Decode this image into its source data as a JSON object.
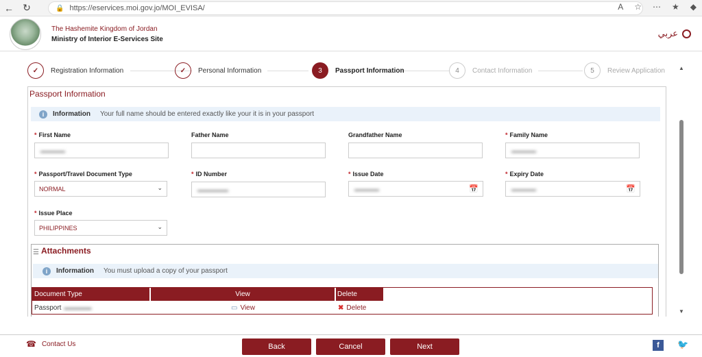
{
  "browser": {
    "url": "https://eservices.moi.gov.jo/MOI_EVISA/"
  },
  "header": {
    "kingdom": "The Hashemite Kingdom of Jordan",
    "ministry": "Ministry of Interior E-Services Site",
    "lang_label": "عربي"
  },
  "steps": [
    {
      "num": "✓",
      "label": "Registration Information",
      "state": "done"
    },
    {
      "num": "✓",
      "label": "Personal Information",
      "state": "done"
    },
    {
      "num": "3",
      "label": "Passport Information",
      "state": "active"
    },
    {
      "num": "4",
      "label": "Contact Information",
      "state": "todo"
    },
    {
      "num": "5",
      "label": "Review Application",
      "state": "todo"
    }
  ],
  "passport": {
    "title": "Passport Information",
    "info_head": "Information",
    "info_msg": "Your full name should be entered exactly like your it is in your passport",
    "fields": {
      "first_name_label": "First Name",
      "father_name_label": "Father Name",
      "grandfather_name_label": "Grandfather Name",
      "family_name_label": "Family Name",
      "doc_type_label": "Passport/Travel Document Type",
      "doc_type_value": "NORMAL",
      "id_number_label": "ID Number",
      "issue_date_label": "Issue Date",
      "expiry_date_label": "Expiry Date",
      "issue_place_label": "Issue Place",
      "issue_place_value": "PHILIPPINES",
      "required_mark": "*"
    }
  },
  "attachments": {
    "title": "Attachments",
    "info_head": "Information",
    "info_msg": "You must upload a copy of your passport",
    "columns": [
      "Document Type",
      "View",
      "Delete"
    ],
    "rows": [
      {
        "doc_type": "Passport",
        "view": "View",
        "delete": "Delete"
      }
    ]
  },
  "footer": {
    "contact": "Contact Us",
    "back": "Back",
    "cancel": "Cancel",
    "next": "Next"
  },
  "colors": {
    "brand": "#8a1c22",
    "info_bg": "#eaf2fa"
  }
}
